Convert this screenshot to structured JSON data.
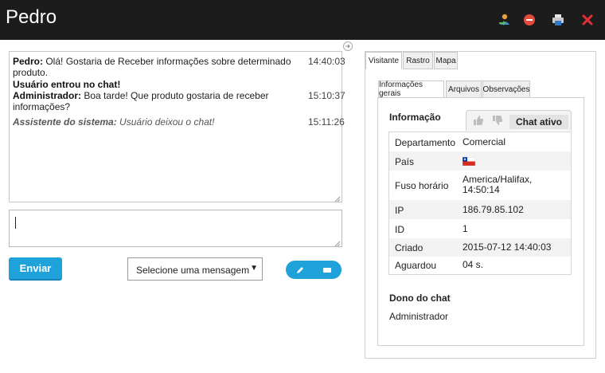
{
  "header": {
    "title": "Pedro",
    "icons": [
      "user-transfer-icon",
      "close-chat-icon",
      "print-icon",
      "close-icon"
    ]
  },
  "chat": {
    "messages": [
      {
        "author": "Pedro:",
        "text": " Olá! Gostaria de Receber informações sobre determinado produto.",
        "time": "14:40:03"
      },
      {
        "author": "",
        "text": "Usuário entrou no chat!",
        "time": ""
      },
      {
        "author": "Administrador:",
        "text": " Boa tarde! Que produto gostaria de receber informações?",
        "time": "15:10:37"
      },
      {
        "author": "Assistente do sistema:",
        "text": " Usuário deixou o chat!",
        "time": "15:11:26"
      }
    ]
  },
  "composer": {
    "send_label": "Enviar",
    "select_value": "Selecione uma mensagem"
  },
  "right": {
    "tabs": [
      "Visitante",
      "Rastro",
      "Mapa"
    ],
    "subtabs": [
      "Informações gerais",
      "Arquivos",
      "Observações"
    ],
    "info_title": "Informação",
    "status_badge": "Chat ativo",
    "info_rows": [
      {
        "key": "Departamento",
        "value": "Comercial"
      },
      {
        "key": "País",
        "value": ""
      },
      {
        "key": "Fuso horário",
        "value": "America/Halifax,",
        "value2": "14:50:14"
      },
      {
        "key": "IP",
        "value": "186.79.85.102"
      },
      {
        "key": "ID",
        "value": "1"
      },
      {
        "key": "Criado",
        "value": "2015-07-12 14:40:03"
      },
      {
        "key": "Aguardou",
        "value": "04 s."
      }
    ],
    "owner_title": "Dono do chat",
    "owner_value": "Administrador"
  },
  "colors": {
    "header_bg": "#1c1c1c",
    "accent": "#1ea2d9",
    "close_red": "#e0303c"
  }
}
